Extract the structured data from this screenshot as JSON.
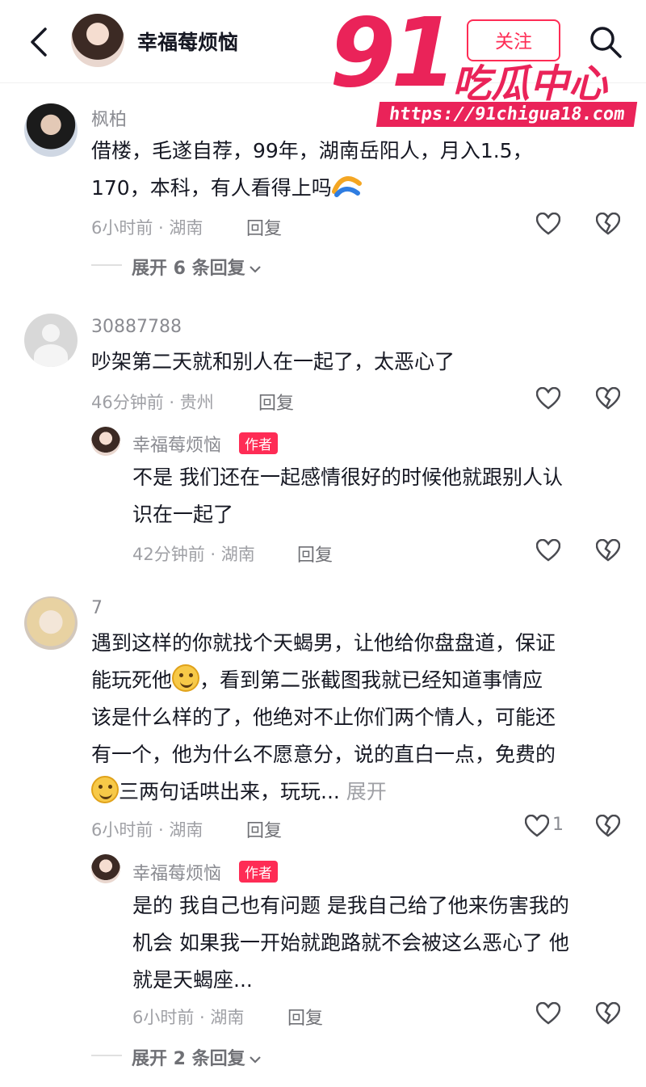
{
  "header": {
    "back_icon": "chevron-left-icon",
    "title": "幸福莓烦恼",
    "follow_label": "关注",
    "search_icon": "search-icon"
  },
  "watermark": {
    "number": "91",
    "text": "吃瓜中心",
    "url": "https://91chigua18.com"
  },
  "comments": [
    {
      "username": "枫柏",
      "text_line1": "借楼，毛遂自荐，99年，湖南岳阳人，月入1.5，",
      "text_line2": "170，本科，有人看得上吗",
      "meta": "6小时前 · 湖南",
      "reply_label": "回复",
      "expand_label": "展开 6 条回复",
      "likes": ""
    },
    {
      "username": "30887788",
      "text": "吵架第二天就和别人在一起了，太恶心了",
      "meta": "46分钟前 · 贵州",
      "reply_label": "回复",
      "reply": {
        "username": "幸福莓烦恼",
        "tag": "作者",
        "text_line1": "不是 我们还在一起感情很好的时候他就跟别人认",
        "text_line2": "识在一起了",
        "meta": "42分钟前 · 湖南",
        "reply_label": "回复"
      }
    },
    {
      "username": "7",
      "text_line1": "遇到这样的你就找个天蝎男，让他给你盘盘道，保证",
      "text_line2a": "能玩死他",
      "text_line2b": "，看到第二张截图我就已经知道事情应",
      "text_line3": "该是什么样的了，他绝对不止你们两个情人，可能还",
      "text_line4": "有一个，他为什么不愿意分，说的直白一点，免费的",
      "text_line5": "三两句话哄出来，玩玩...",
      "more_label": "展开",
      "meta": "6小时前 · 湖南",
      "reply_label": "回复",
      "likes": "1",
      "reply": {
        "username": "幸福莓烦恼",
        "tag": "作者",
        "text_line1": "是的 我自己也有问题 是我自己给了他来伤害我的",
        "text_line2": "机会 如果我一开始就跑路就不会被这么恶心了 他",
        "text_line3": "就是天蝎座...",
        "meta": "6小时前 · 湖南",
        "reply_label": "回复"
      },
      "expand_label": "展开 2 条回复"
    }
  ]
}
